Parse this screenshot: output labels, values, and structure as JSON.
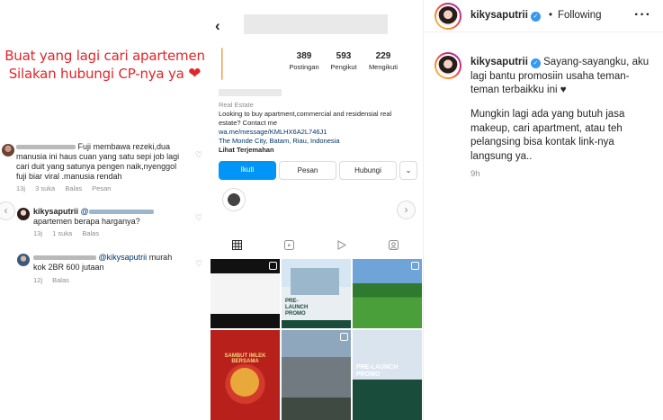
{
  "left": {
    "caption_line1": "Buat yang lagi cari apartemen",
    "caption_line2": "Silakan hubungi CP-nya ya",
    "heart": "❤",
    "comment1": {
      "text_line1": "Fuji membawa rezeki,dua",
      "text_line2": "manusia ini haus cuan yang satu sepi job lagi",
      "text_line3": "cari duit yang satunya pengen naik,nyenggol",
      "text_line4": "fuji biar viral .manusia rendah",
      "time": "13j",
      "likes": "3 suka",
      "reply": "Balas",
      "translate": "Pesan"
    },
    "comment2": {
      "user": "kikysaputrii",
      "mention": "@",
      "text": "apartemen berapa harganya?",
      "time": "13j",
      "likes": "1 suka",
      "reply": "Balas"
    },
    "comment3": {
      "mention": "@kikysaputrii",
      "text_after": "murah",
      "text_line2": "kok 2BR 600 jutaan",
      "time": "12j",
      "reply": "Balas"
    },
    "prev_icon": "‹"
  },
  "profile": {
    "back_icon": "‹",
    "posts_count": "389",
    "posts_label": "Postingan",
    "followers_count": "593",
    "followers_label": "Pengikut",
    "following_count": "229",
    "following_label": "Mengikuti",
    "category": "Real Estate",
    "bio_line1": "Looking to buy apartment,commercial and residensial real",
    "bio_line2": "estate? Contact me",
    "link": "wa.me/message/KMLHX6A2L746J1",
    "location": "The Monde City, Batam, Riau, Indonesia",
    "translate": "Lihat Terjemahan",
    "btn_follow": "Ikuti",
    "btn_message": "Pesan",
    "btn_contact": "Hubungi",
    "btn_more": "⌄",
    "next_icon": "›",
    "tile2_text": "PRE-LAUNCH PROMO",
    "tile4_text": "SAMBUT IMLEK BERSAMA",
    "tile6_text": "PRE-LAUNCH PROMO"
  },
  "post": {
    "username": "kikysaputrii",
    "separator": "•",
    "following": "Following",
    "more": "···",
    "caption_user": "kikysaputrii",
    "caption_text": "Sayang-sayangku, aku lagi bantu promosiin usaha teman-teman terbaikku ini ♥",
    "caption_p2": "Mungkin lagi ada yang butuh jasa makeup, cari apartment, atau teh pelangsing bisa kontak link-nya langsung ya..",
    "time": "9h"
  },
  "colors": {
    "accent_blue": "#0095f6",
    "verified_blue": "#3897f0",
    "caption_red": "#e1262b"
  }
}
